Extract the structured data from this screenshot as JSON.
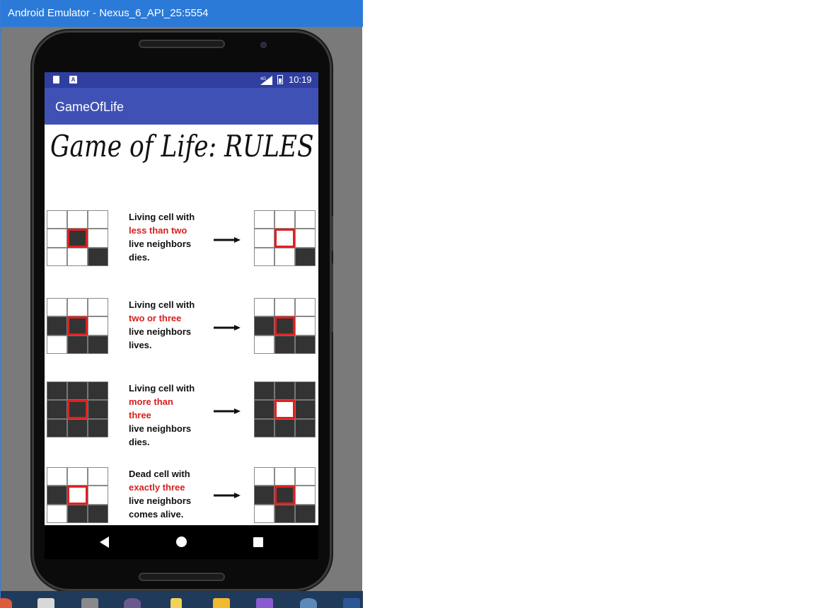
{
  "window": {
    "title": "Android Emulator - Nexus_6_API_25:5554"
  },
  "status_bar": {
    "network": "4G",
    "time": "10:19"
  },
  "app_bar": {
    "title": "GameOfLife"
  },
  "content": {
    "heading": "Game of Life: RULES",
    "rules": [
      {
        "line1": "Living cell with",
        "highlight": "less than two",
        "line3": "live neighbors",
        "line4": "dies.",
        "before": [
          0,
          0,
          0,
          0,
          1,
          0,
          0,
          0,
          1
        ],
        "after": [
          0,
          0,
          0,
          0,
          0,
          0,
          0,
          0,
          1
        ]
      },
      {
        "line1": "Living cell with",
        "highlight": "two or three",
        "line3": "live neighbors",
        "line4": "lives.",
        "before": [
          0,
          0,
          0,
          1,
          1,
          0,
          0,
          1,
          1
        ],
        "after": [
          0,
          0,
          0,
          1,
          1,
          0,
          0,
          1,
          1
        ]
      },
      {
        "line1": "Living cell with",
        "highlight": "more than three",
        "line3": "live neighbors",
        "line4": "dies.",
        "before": [
          1,
          1,
          1,
          1,
          1,
          1,
          1,
          1,
          1
        ],
        "after": [
          1,
          1,
          1,
          1,
          0,
          1,
          1,
          1,
          1
        ]
      },
      {
        "line1": "Dead cell with",
        "highlight": "exactly three",
        "line3": "live neighbors",
        "line4": "comes alive.",
        "before": [
          0,
          0,
          0,
          1,
          0,
          0,
          0,
          1,
          1
        ],
        "after": [
          0,
          0,
          0,
          1,
          1,
          0,
          0,
          1,
          1
        ]
      }
    ]
  },
  "nav": {
    "back": "back-icon",
    "home": "home-icon",
    "recents": "recents-icon"
  },
  "colors": {
    "status_bar": "#303f9f",
    "app_bar": "#3f51b5",
    "highlight": "#d62020",
    "live_cell": "#333333"
  }
}
